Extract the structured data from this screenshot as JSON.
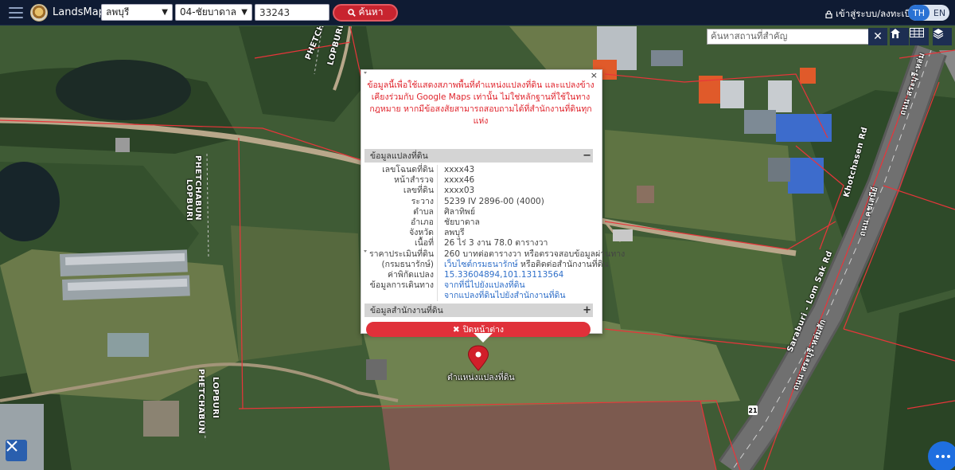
{
  "header": {
    "brand": "LandsMaps",
    "province": "ลพบุรี",
    "amphoe": "04-ชัยบาดาล",
    "parcel_no": "33243",
    "search_label": "ค้นหา",
    "login_label": "เข้าสู่ระบบ/ลงทะเบียน",
    "lang_th": "TH",
    "lang_en": "EN"
  },
  "map": {
    "place_search_placeholder": "ค้นหาสถานที่สำคัญ",
    "road_labels": {
      "phetch_top": "PHETCH",
      "lopburi_top": "LOPBURI",
      "lopburi_mid": "LOPBURI",
      "phetchabun_mid": "PHETCHABUN",
      "phetchabun_bot": "PHETCHABUN",
      "lopburi_bot": "LOPBURI",
      "khotchasen": "Khotchasen Rd",
      "saraburi": "Saraburi - Lom Sak Rd",
      "thai_kotchasen": "ถนน คชเสนีย์",
      "thai_saraburi_top": "ถนน สระบุรี-หล่ม",
      "thai_saraburi_bot": "ถนน สระบุรี-หล่มสัก"
    },
    "highway_shield": "21",
    "pin_label": "ตำแหน่งแปลงที่ดิน"
  },
  "popup": {
    "notice": "ข้อมูลนี้เพื่อใช้แสดงสภาพพื้นที่ตำแหน่งแปลงที่ดิน และแปลงข้างเคียงร่วมกับ Google Maps เท่านั้น ไม่ใช่หลักฐานที่ใช้ในทางกฎหมาย หากมีข้อสงสัยสามารถสอบถามได้ที่สำนักงานที่ดินทุกแห่ง",
    "section_parcel": "ข้อมูลแปลงที่ดิน",
    "section_office": "ข้อมูลสำนักงานที่ดิน",
    "rows": {
      "deed_label": "เลขโฉนดที่ดิน",
      "deed_value": "xxxx43",
      "survey_label": "หน้าสำรวจ",
      "survey_value": "xxxx46",
      "land_label": "เลขที่ดิน",
      "land_value": "xxxx03",
      "sheet_label": "ระวาง",
      "sheet_value": "5239 IV 2896-00 (4000)",
      "tambon_label": "ตำบล",
      "tambon_value": "ศิลาทิพย์",
      "amphoe_label": "อำเภอ",
      "amphoe_value": "ชัยบาดาล",
      "province_label": "จังหวัด",
      "province_value": "ลพบุรี",
      "area_label": "เนื้อที่",
      "area_value": "26 ไร่ 3 งาน 78.0 ตารางวา",
      "price_label": "ราคาประเมินที่ดิน",
      "price_value": "260 บาทต่อตารางวา หรือตรวจสอบข้อมูลผ่านทาง",
      "price_label2": "(กรมธนารักษ์)",
      "price_link": "เว็บไซต์กรมธนารักษ์",
      "price_tail": " หรือติดต่อสำนักงานที่ดิน",
      "coord_label": "ค่าพิกัดแปลง",
      "coord_value": "15.33604894,101.13113564",
      "travel_label": "ข้อมูลการเดินทาง",
      "travel_value1": "จากที่นี่ไปยังแปลงที่ดิน",
      "travel_value2": "จากแปลงที่ดินไปยังสำนักงานที่ดิน"
    },
    "close_label": "ปิดหน้าต่าง",
    "close_x": "×"
  }
}
